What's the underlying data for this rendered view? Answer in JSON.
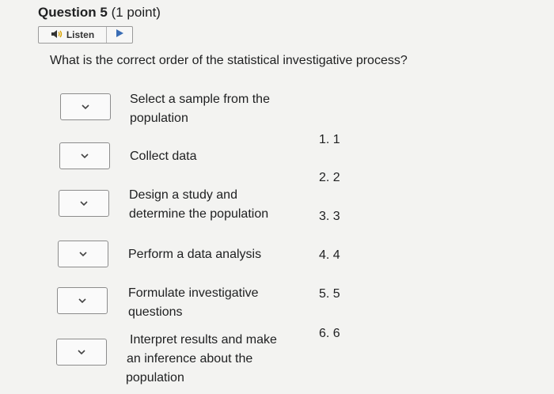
{
  "question": {
    "title": "Question 5",
    "points": "(1 point)",
    "prompt": "What is the correct order of the statistical investigative process?"
  },
  "listen": {
    "label": "Listen",
    "icon": "speaker-icon",
    "play_icon": "play-icon"
  },
  "items": [
    {
      "line1": "Select a sample from the",
      "line2": "population",
      "line3": ""
    },
    {
      "line1": "Collect data",
      "line2": "",
      "line3": ""
    },
    {
      "line1": "Design a study and",
      "line2": "determine the population",
      "line3": ""
    },
    {
      "line1": "Perform a data analysis",
      "line2": "",
      "line3": ""
    },
    {
      "line1": "Formulate investigative",
      "line2": "questions",
      "line3": ""
    },
    {
      "line1": "Interpret results and make",
      "line2": "an inference about the",
      "line3": "population"
    }
  ],
  "options": [
    "1.  1",
    "2.  2",
    "3.  3",
    "4.  4",
    "5.  5",
    "6.  6"
  ]
}
